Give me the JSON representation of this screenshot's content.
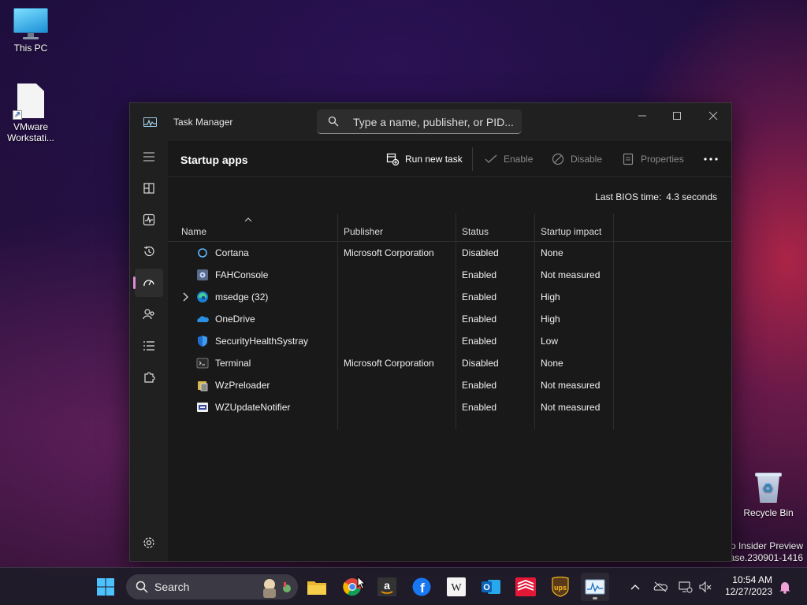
{
  "desktop": {
    "icons": [
      {
        "label": "This PC"
      },
      {
        "label": "VMware Workstati..."
      },
      {
        "label": "Recycle Bin"
      }
    ],
    "watermark_line1": "ro Insider Preview",
    "watermark_line2": "ease.230901-1416"
  },
  "window": {
    "title": "Task Manager",
    "search_placeholder": "Type a name, publisher, or PID...",
    "page_title": "Startup apps",
    "commands": {
      "run_new_task": "Run new task",
      "enable": "Enable",
      "disable": "Disable",
      "properties": "Properties"
    },
    "bios_label": "Last BIOS time:",
    "bios_value": "4.3 seconds",
    "columns": [
      "Name",
      "Publisher",
      "Status",
      "Startup impact"
    ],
    "rows": [
      {
        "name": "Cortana",
        "publisher": "Microsoft Corporation",
        "status": "Disabled",
        "impact": "None",
        "icon": "cortana-icon"
      },
      {
        "name": "FAHConsole",
        "publisher": "",
        "status": "Enabled",
        "impact": "Not measured",
        "icon": "fah-icon"
      },
      {
        "name": "msedge (32)",
        "publisher": "",
        "status": "Enabled",
        "impact": "High",
        "icon": "edge-icon"
      },
      {
        "name": "OneDrive",
        "publisher": "",
        "status": "Enabled",
        "impact": "High",
        "icon": "onedrive-icon"
      },
      {
        "name": "SecurityHealthSystray",
        "publisher": "",
        "status": "Enabled",
        "impact": "Low",
        "icon": "shield-icon"
      },
      {
        "name": "Terminal",
        "publisher": "Microsoft Corporation",
        "status": "Disabled",
        "impact": "None",
        "icon": "terminal-icon"
      },
      {
        "name": "WzPreloader",
        "publisher": "",
        "status": "Enabled",
        "impact": "Not measured",
        "icon": "winzip-icon"
      },
      {
        "name": "WZUpdateNotifier",
        "publisher": "",
        "status": "Enabled",
        "impact": "Not measured",
        "icon": "wz-update-icon"
      }
    ]
  },
  "taskbar": {
    "search_label": "Search",
    "time": "10:54 AM",
    "date": "12/27/2023"
  },
  "colors": {
    "accent": "#e08ad8",
    "window_bg": "#191919",
    "sidebar_bg": "#202020"
  }
}
